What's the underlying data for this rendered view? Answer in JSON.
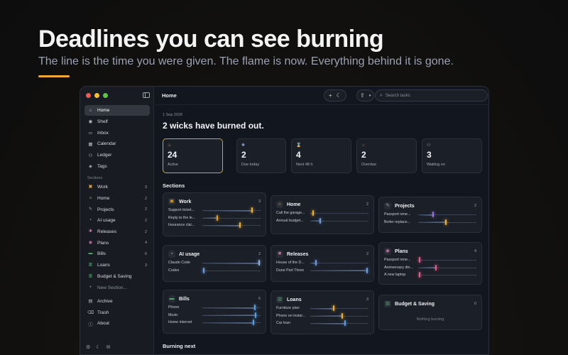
{
  "hero": {
    "title": "Deadlines you can see burning",
    "subtitle": "The line is the time you were given. The flame is now. Everything behind it is gone."
  },
  "sidebar": {
    "nav": [
      {
        "label": "Home",
        "icon": "home-icon",
        "glyph": "⌂"
      },
      {
        "label": "Shelf",
        "icon": "shelf-icon",
        "glyph": "◉"
      },
      {
        "label": "Inbox",
        "icon": "inbox-icon",
        "glyph": "▭"
      },
      {
        "label": "Calendar",
        "icon": "calendar-icon",
        "glyph": "▦"
      },
      {
        "label": "Ledger",
        "icon": "ledger-icon",
        "glyph": "⚇"
      },
      {
        "label": "Tags",
        "icon": "tag-icon",
        "glyph": "◈"
      }
    ],
    "sections_label": "Sections",
    "sections": [
      {
        "label": "Work",
        "count": "3",
        "glyph": "▣",
        "color": "#e0a02a"
      },
      {
        "label": "Home",
        "count": "2",
        "glyph": "⌂",
        "color": "#e8c07a"
      },
      {
        "label": "Projects",
        "count": "2",
        "glyph": "✎",
        "color": "#a0a4ad"
      },
      {
        "label": "AI usage",
        "count": "2",
        "glyph": "▪",
        "color": "#8e92a8"
      },
      {
        "label": "Releases",
        "count": "2",
        "glyph": "✱",
        "color": "#d46ab0"
      },
      {
        "label": "Plans",
        "count": "4",
        "glyph": "◉",
        "color": "#d46ab0"
      },
      {
        "label": "Bills",
        "count": "6",
        "glyph": "▬",
        "color": "#4fb06a"
      },
      {
        "label": "Loans",
        "count": "3",
        "glyph": "▥",
        "color": "#4fb06a"
      },
      {
        "label": "Budget & Saving",
        "count": "",
        "glyph": "▥",
        "color": "#4fb06a"
      }
    ],
    "new_section": "New Section...",
    "bottom": [
      {
        "label": "Archive",
        "glyph": "▤"
      },
      {
        "label": "Trash",
        "glyph": "⌫"
      },
      {
        "label": "About",
        "glyph": "ⓘ"
      }
    ]
  },
  "topbar": {
    "title": "Home",
    "search_placeholder": "Search tasks"
  },
  "main": {
    "date": "1 Sep 2026",
    "headline": "2 wicks have burned out."
  },
  "stats": [
    {
      "num": "24",
      "label": "Active",
      "icon": "flame-icon",
      "glyph": "♨",
      "color": "#e0a02a"
    },
    {
      "num": "2",
      "label": "Due today",
      "icon": "sun-icon",
      "glyph": "✺",
      "color": "#7aa6e0"
    },
    {
      "num": "4",
      "label": "Next 48 h",
      "icon": "hourglass-icon",
      "glyph": "⌛",
      "color": "#e0a02a"
    },
    {
      "num": "2",
      "label": "Overdue",
      "icon": "fire-icon",
      "glyph": "♨",
      "color": "#e8643a"
    },
    {
      "num": "3",
      "label": "Waiting on",
      "icon": "people-icon",
      "glyph": "⚇",
      "color": "#9aa0aa"
    }
  ],
  "sections_heading": "Sections",
  "cards": [
    {
      "name": "Work",
      "count": "3",
      "glyph": "▣",
      "color": "#e0a02a",
      "tasks": [
        {
          "name": "Support ticket...",
          "progress": 0.85,
          "flame": "#f0b030"
        },
        {
          "name": "Reply to the le...",
          "progress": 0.25,
          "flame": "#e0a02a"
        },
        {
          "name": "Insurance clai...",
          "progress": 0.65,
          "flame": "#f0b030"
        }
      ]
    },
    {
      "name": "Home",
      "count": "2",
      "glyph": "⌂",
      "color": "#e8c07a",
      "tasks": [
        {
          "name": "Call the garage...",
          "progress": 0.05,
          "flame": "#f0b030"
        },
        {
          "name": "Annual budget...",
          "progress": 0.17,
          "flame": "#6a9ae0"
        }
      ]
    },
    {
      "name": "Projects",
      "count": "2",
      "glyph": "✎",
      "color": "#a0a4ad",
      "tasks": [
        {
          "name": "Passport rene...",
          "progress": 0.25,
          "flame": "#a070e0"
        },
        {
          "name": "Boiler replace...",
          "progress": 0.47,
          "flame": "#f0b030"
        }
      ]
    },
    {
      "name": "AI usage",
      "count": "2",
      "glyph": "▪",
      "color": "#8e92a8",
      "tasks": [
        {
          "name": "Claude Code",
          "progress": 0.97,
          "flame": "#8fb0e0"
        },
        {
          "name": "Codex",
          "progress": 0.02,
          "flame": "#6a9ae0"
        }
      ]
    },
    {
      "name": "Releases",
      "count": "2",
      "glyph": "✱",
      "color": "#d46ab0",
      "tasks": [
        {
          "name": "House of the D...",
          "progress": 0.1,
          "flame": "#6a9ae0"
        },
        {
          "name": "Dune Part Three",
          "progress": 0.98,
          "flame": "#6a9ae0"
        }
      ]
    },
    {
      "name": "Plans",
      "count": "4",
      "glyph": "◉",
      "color": "#d46ab0",
      "tasks": [
        {
          "name": "Passport rene...",
          "progress": 0.02,
          "flame": "#e85a8a"
        },
        {
          "name": "Anniversary din...",
          "progress": 0.3,
          "flame": "#e85a8a"
        },
        {
          "name": "A new laptop",
          "progress": 0.03,
          "flame": "#e85a8a"
        }
      ]
    },
    {
      "name": "Bills",
      "count": "6",
      "glyph": "▬",
      "color": "#4fb06a",
      "tasks": [
        {
          "name": "Phone",
          "progress": 0.9,
          "flame": "#5a9ee0"
        },
        {
          "name": "Music",
          "progress": 0.92,
          "flame": "#5a9ee0"
        },
        {
          "name": "Home internet",
          "progress": 0.88,
          "flame": "#5a9ee0"
        }
      ]
    },
    {
      "name": "Loans",
      "count": "3",
      "glyph": "▥",
      "color": "#4fb06a",
      "tasks": [
        {
          "name": "Furniture plan",
          "progress": 0.4,
          "flame": "#f0b030"
        },
        {
          "name": "Phone on instal...",
          "progress": 0.55,
          "flame": "#f0b030"
        },
        {
          "name": "Car loan",
          "progress": 0.6,
          "flame": "#5a9ee0"
        }
      ]
    },
    {
      "name": "Budget & Saving",
      "count": "0",
      "glyph": "▥",
      "color": "#4fb06a",
      "tasks": [],
      "empty": "Nothing burning"
    }
  ],
  "burning_heading": "Burning next"
}
